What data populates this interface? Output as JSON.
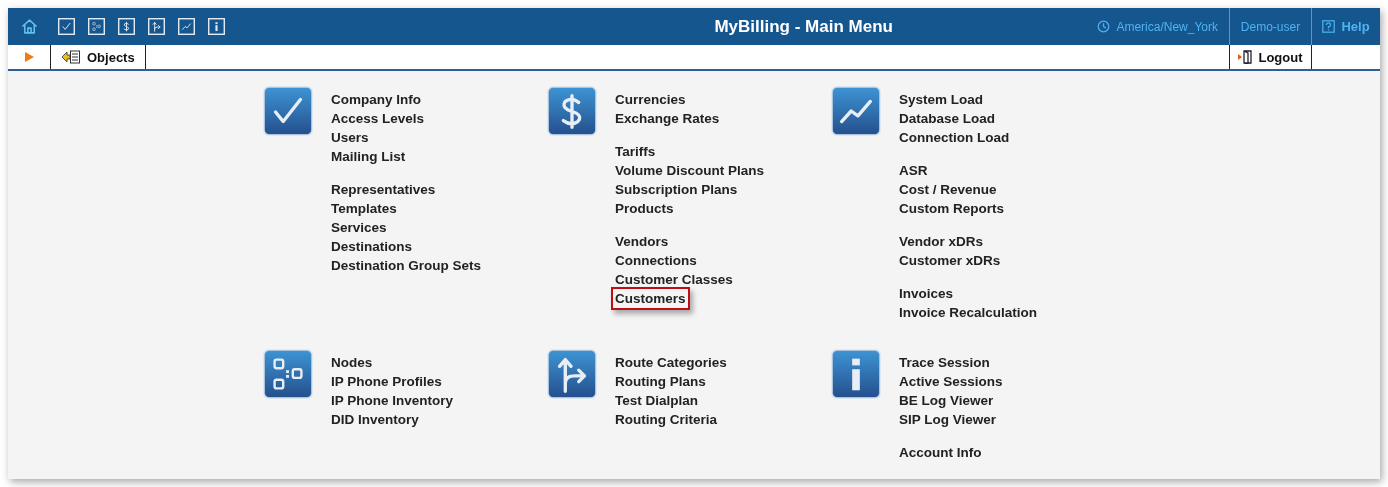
{
  "toolbar": {
    "icons": [
      {
        "kind": "home"
      },
      {
        "kind": "check"
      },
      {
        "kind": "nodes"
      },
      {
        "kind": "dollar"
      },
      {
        "kind": "route"
      },
      {
        "kind": "chart"
      },
      {
        "kind": "info"
      }
    ]
  },
  "window": {
    "title": "MyBilling - Main Menu"
  },
  "header_right": {
    "timezone": "America/New_York",
    "user": "Demo-user",
    "help": "Help"
  },
  "subbar": {
    "objects": "Objects",
    "logout": "Logout"
  },
  "sections": [
    {
      "kind": "check",
      "groups": [
        [
          {
            "label": "Company Info",
            "highlighted": false
          },
          {
            "label": "Access Levels",
            "highlighted": false
          },
          {
            "label": "Users",
            "highlighted": false
          },
          {
            "label": "Mailing List",
            "highlighted": false
          }
        ],
        [
          {
            "label": "Representatives",
            "highlighted": false
          },
          {
            "label": "Templates",
            "highlighted": false
          },
          {
            "label": "Services",
            "highlighted": false
          },
          {
            "label": "Destinations",
            "highlighted": false
          },
          {
            "label": "Destination Group Sets",
            "highlighted": false
          }
        ]
      ]
    },
    {
      "kind": "dollar",
      "groups": [
        [
          {
            "label": "Currencies",
            "highlighted": false
          },
          {
            "label": "Exchange Rates",
            "highlighted": false
          }
        ],
        [
          {
            "label": "Tariffs",
            "highlighted": false
          },
          {
            "label": "Volume Discount Plans",
            "highlighted": false
          },
          {
            "label": "Subscription Plans",
            "highlighted": false
          },
          {
            "label": "Products",
            "highlighted": false
          }
        ],
        [
          {
            "label": "Vendors",
            "highlighted": false
          },
          {
            "label": "Connections",
            "highlighted": false
          },
          {
            "label": "Customer Classes",
            "highlighted": false
          },
          {
            "label": "Customers",
            "highlighted": true
          }
        ]
      ]
    },
    {
      "kind": "chart",
      "groups": [
        [
          {
            "label": "System Load",
            "highlighted": false
          },
          {
            "label": "Database Load",
            "highlighted": false
          },
          {
            "label": "Connection Load",
            "highlighted": false
          }
        ],
        [
          {
            "label": "ASR",
            "highlighted": false
          },
          {
            "label": "Cost / Revenue",
            "highlighted": false
          },
          {
            "label": "Custom Reports",
            "highlighted": false
          }
        ],
        [
          {
            "label": "Vendor xDRs",
            "highlighted": false
          },
          {
            "label": "Customer xDRs",
            "highlighted": false
          }
        ],
        [
          {
            "label": "Invoices",
            "highlighted": false
          },
          {
            "label": "Invoice Recalculation",
            "highlighted": false
          }
        ]
      ]
    },
    {
      "kind": "nodes",
      "groups": [
        [
          {
            "label": "Nodes",
            "highlighted": false
          },
          {
            "label": "IP Phone Profiles",
            "highlighted": false
          },
          {
            "label": "IP Phone Inventory",
            "highlighted": false
          },
          {
            "label": "DID Inventory",
            "highlighted": false
          }
        ]
      ]
    },
    {
      "kind": "route",
      "groups": [
        [
          {
            "label": "Route Categories",
            "highlighted": false
          },
          {
            "label": "Routing Plans",
            "highlighted": false
          },
          {
            "label": "Test Dialplan",
            "highlighted": false
          },
          {
            "label": "Routing Criteria",
            "highlighted": false
          }
        ]
      ]
    },
    {
      "kind": "info",
      "groups": [
        [
          {
            "label": "Trace Session",
            "highlighted": false
          },
          {
            "label": "Active Sessions",
            "highlighted": false
          },
          {
            "label": "BE Log Viewer",
            "highlighted": false
          },
          {
            "label": "SIP Log Viewer",
            "highlighted": false
          }
        ],
        [
          {
            "label": "Account Info",
            "highlighted": false
          }
        ]
      ]
    }
  ]
}
